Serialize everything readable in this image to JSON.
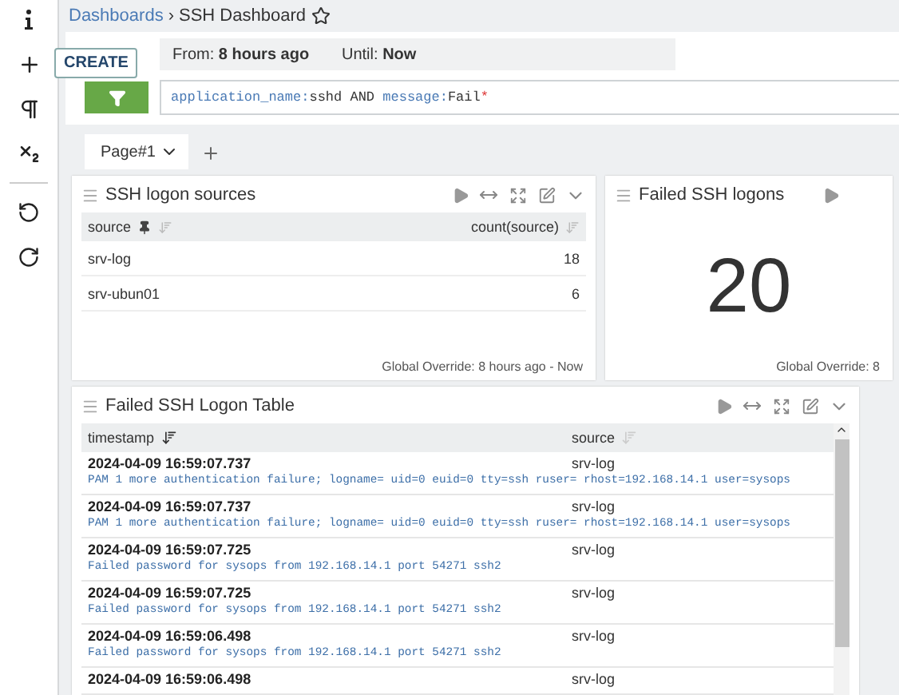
{
  "sidebar": {
    "items": [
      {
        "kind": "info"
      },
      {
        "kind": "create",
        "tooltip": "CREATE"
      },
      {
        "kind": "paragraph"
      },
      {
        "kind": "subscript"
      },
      {
        "kind": "undo"
      },
      {
        "kind": "redo"
      }
    ]
  },
  "breadcrumb": {
    "parent": "Dashboards",
    "separator": "›",
    "current": "SSH Dashboard",
    "starred": false
  },
  "time_range": {
    "from_label": "From:",
    "from": "8 hours ago",
    "until_label": "Until:",
    "until": "Now"
  },
  "query": [
    {
      "kind": "key",
      "text": "application_name:"
    },
    {
      "kind": "value",
      "text": "sshd AND "
    },
    {
      "kind": "key",
      "text": "message:"
    },
    {
      "kind": "value",
      "text": "Fail"
    },
    {
      "kind": "wildcard",
      "text": "*"
    }
  ],
  "pages": [
    {
      "label": "Page#1",
      "selected": true
    }
  ],
  "widgets": [
    {
      "title": "SSH logon sources",
      "kind": "table",
      "columns": [
        {
          "label": "source",
          "pinned": true
        },
        {
          "label": "count(source)",
          "pinned": false
        }
      ],
      "rows": [
        [
          "srv-log",
          "18"
        ],
        [
          "srv-ubun01",
          "6"
        ]
      ],
      "footer": "Global Override: 8 hours ago - Now"
    },
    {
      "title": "Failed SSH logons",
      "kind": "number",
      "value": "20",
      "footer": "Global Override: 8"
    }
  ],
  "log_table": {
    "title": "Failed SSH Logon Table",
    "columns": [
      {
        "label": "timestamp",
        "sorted": true
      },
      {
        "label": "source",
        "sorted": false
      }
    ],
    "rows": [
      {
        "timestamp": "2024-04-09 16:59:07.737",
        "source": "srv-log",
        "message": "PAM 1 more authentication failure; logname= uid=0 euid=0 tty=ssh ruser= rhost=192.168.14.1 user=sysops"
      },
      {
        "timestamp": "2024-04-09 16:59:07.737",
        "source": "srv-log",
        "message": "PAM 1 more authentication failure; logname= uid=0 euid=0 tty=ssh ruser= rhost=192.168.14.1 user=sysops"
      },
      {
        "timestamp": "2024-04-09 16:59:07.725",
        "source": "srv-log",
        "message": "Failed password for sysops from 192.168.14.1 port 54271 ssh2"
      },
      {
        "timestamp": "2024-04-09 16:59:07.725",
        "source": "srv-log",
        "message": "Failed password for sysops from 192.168.14.1 port 54271 ssh2"
      },
      {
        "timestamp": "2024-04-09 16:59:06.498",
        "source": "srv-log",
        "message": "Failed password for sysops from 192.168.14.1 port 54271 ssh2"
      },
      {
        "timestamp": "2024-04-09 16:59:06.498",
        "source": "srv-log"
      }
    ]
  }
}
